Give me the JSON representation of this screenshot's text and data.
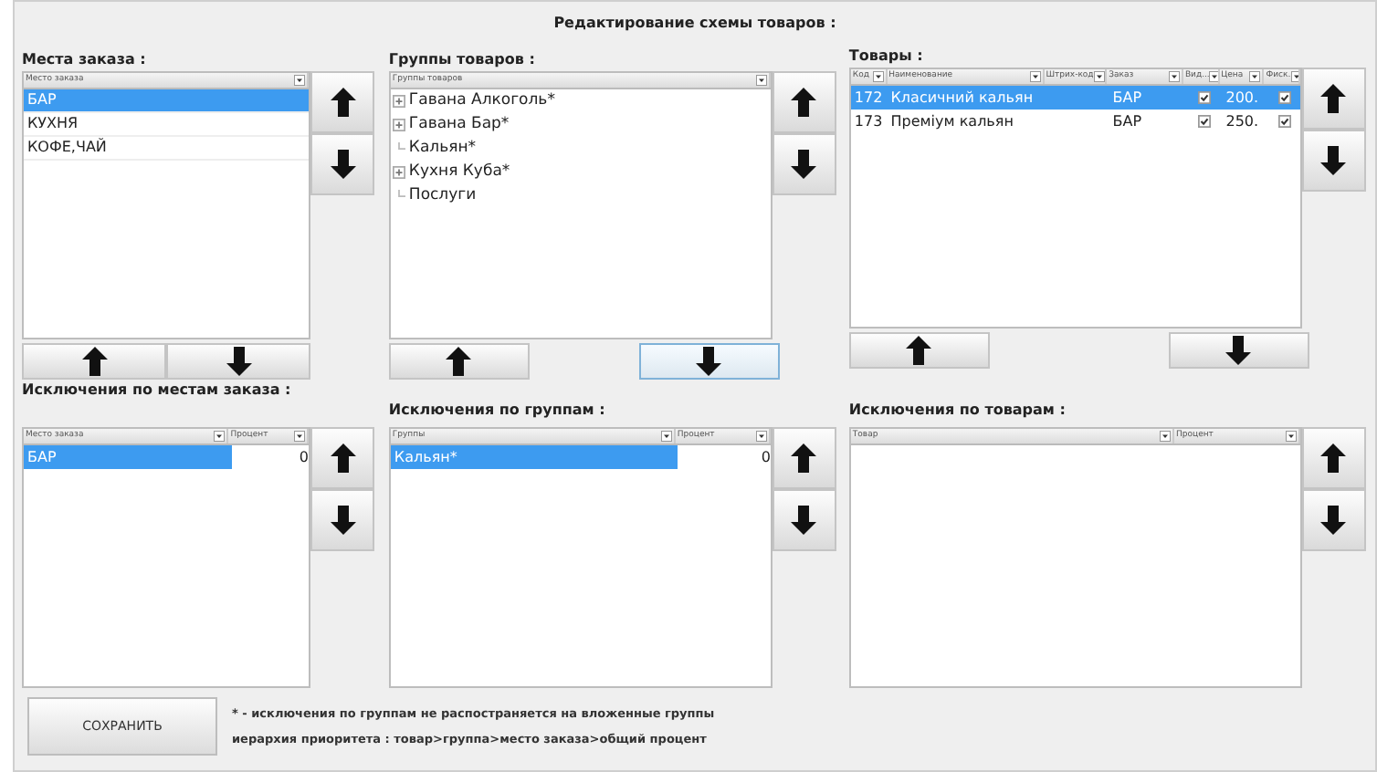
{
  "title": "Редактирование схемы товаров :",
  "panels": [
    {
      "kind": "grid",
      "label": "Места заказа :",
      "columns": [
        {
          "label": "Место заказа"
        }
      ],
      "rows": [
        {
          "selected": true,
          "cells": [
            {
              "kind": "text",
              "text": "БАР"
            }
          ]
        },
        {
          "selected": false,
          "cells": [
            {
              "kind": "text",
              "text": "КУХНЯ"
            }
          ]
        },
        {
          "selected": false,
          "cells": [
            {
              "kind": "text",
              "text": "КОФЕ,ЧАЙ"
            }
          ]
        }
      ],
      "bottom_buttons": [
        {
          "kind": "up",
          "focused": false
        },
        {
          "kind": "down",
          "focused": false
        }
      ]
    },
    {
      "kind": "tree",
      "label": "Группы товаров :",
      "columns": [
        {
          "label": "Группы товаров"
        }
      ],
      "items": [
        {
          "label": "Гавана Алкоголь*",
          "expandable": true
        },
        {
          "label": "Гавана Бар*",
          "expandable": true
        },
        {
          "label": "Кальян*",
          "expandable": false
        },
        {
          "label": "Кухня Куба*",
          "expandable": true
        },
        {
          "label": "Послуги",
          "expandable": false
        }
      ],
      "bottom_buttons": [
        {
          "kind": "up",
          "focused": false
        },
        {
          "kind": "down",
          "focused": true
        }
      ]
    },
    {
      "kind": "grid",
      "label": "Товары :",
      "columns": [
        {
          "label": "Код"
        },
        {
          "label": "Наименование"
        },
        {
          "label": "Штрих-код"
        },
        {
          "label": "Заказ"
        },
        {
          "label": "Вид..."
        },
        {
          "label": "Цена"
        },
        {
          "label": "Фиск."
        }
      ],
      "rows": [
        {
          "selected": true,
          "cells": [
            {
              "kind": "text",
              "text": "172"
            },
            {
              "kind": "text",
              "text": "Класичний кальян"
            },
            {
              "kind": "empty"
            },
            {
              "kind": "text",
              "text": "БАР"
            },
            {
              "kind": "check",
              "checked": true
            },
            {
              "kind": "text",
              "text": "200."
            },
            {
              "kind": "check",
              "checked": true
            }
          ]
        },
        {
          "selected": false,
          "cells": [
            {
              "kind": "text",
              "text": "173"
            },
            {
              "kind": "text",
              "text": "Преміум кальян"
            },
            {
              "kind": "empty"
            },
            {
              "kind": "text",
              "text": "БАР"
            },
            {
              "kind": "check",
              "checked": true
            },
            {
              "kind": "text",
              "text": "250."
            },
            {
              "kind": "check",
              "checked": true
            }
          ]
        }
      ],
      "bottom_buttons": [
        {
          "kind": "up",
          "focused": false
        },
        {
          "kind": "down",
          "focused": false
        }
      ]
    }
  ],
  "exclusions": [
    {
      "label": "Исключения по местам заказа :",
      "columns": [
        {
          "label": "Место заказа"
        },
        {
          "label": "Процент"
        }
      ],
      "rows": [
        {
          "selected": true,
          "cells": [
            {
              "kind": "text",
              "text": "БАР"
            },
            {
              "kind": "number",
              "text": "0"
            }
          ]
        }
      ]
    },
    {
      "label": "Исключения по группам :",
      "columns": [
        {
          "label": "Группы"
        },
        {
          "label": "Процент"
        }
      ],
      "rows": [
        {
          "selected": true,
          "cells": [
            {
              "kind": "text",
              "text": "Кальян*"
            },
            {
              "kind": "number",
              "text": "0"
            }
          ]
        }
      ]
    },
    {
      "label": "Исключения по товарам :",
      "columns": [
        {
          "label": "Товар"
        },
        {
          "label": "Процент"
        }
      ]
    }
  ],
  "save_button": "СОХРАНИТЬ",
  "notes": [
    "* - исключения по группам не распостраняется на вложенные группы",
    "иерархия приоритета : товар>группа>место заказа>общий процент"
  ]
}
